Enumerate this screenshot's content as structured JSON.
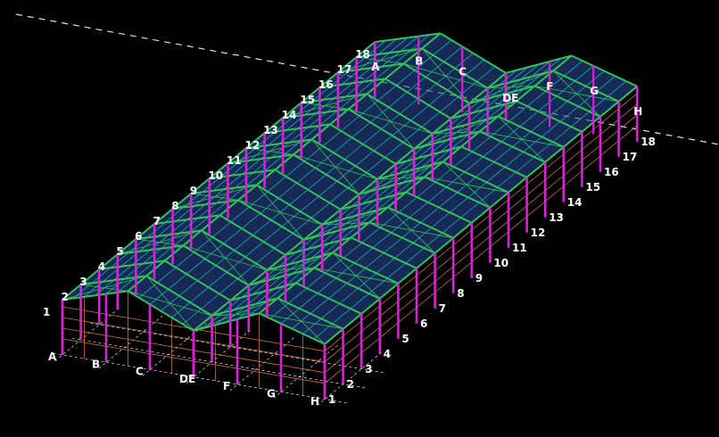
{
  "model": {
    "gable_grid_labels": [
      "A",
      "B",
      "C",
      "DE",
      "F",
      "G",
      "H"
    ],
    "frame_grid_labels": [
      "1",
      "2",
      "3",
      "4",
      "5",
      "6",
      "7",
      "8",
      "9",
      "10",
      "11",
      "12",
      "13",
      "14",
      "15",
      "16",
      "17",
      "18"
    ]
  },
  "colors": {
    "background": "#000000",
    "column": "#d822d8",
    "rafter": "#33c25a",
    "purlin": "#18b4c8",
    "cladding": "#2a4a9a",
    "girt": "#d07030",
    "grid_line": "#e6e6e6",
    "label": "#ffffff"
  }
}
